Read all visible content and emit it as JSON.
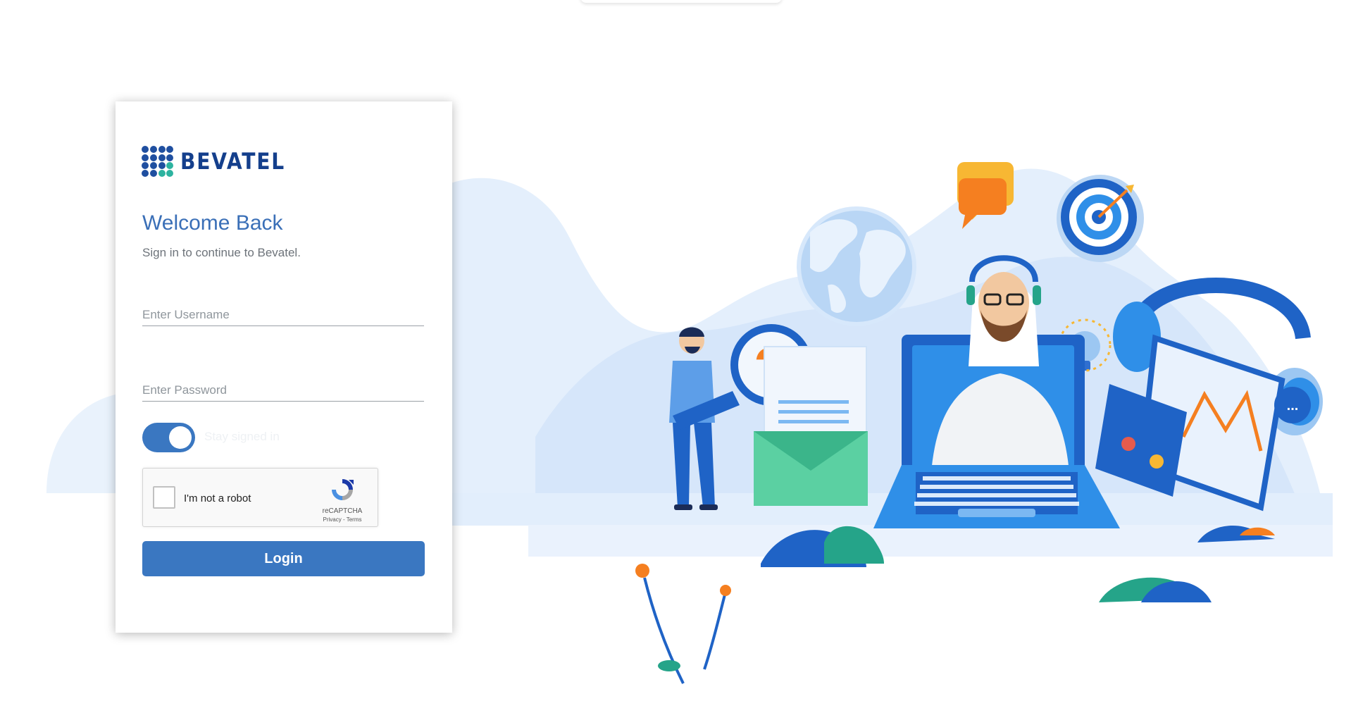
{
  "brand": {
    "name": "BEVATEL"
  },
  "login": {
    "title": "Welcome Back",
    "subtitle": "Sign in to continue to Bevatel.",
    "username_placeholder": "Enter Username",
    "password_placeholder": "Enter Password",
    "stay_signed_in_label": "Stay signed in",
    "stay_signed_in_on": true,
    "login_label": "Login"
  },
  "captcha": {
    "label": "I'm not a robot",
    "brand": "reCAPTCHA",
    "links": "Privacy - Terms"
  },
  "colors": {
    "primary": "#3a77c1",
    "title": "#3a6fb7",
    "logo": "#143f8c"
  }
}
